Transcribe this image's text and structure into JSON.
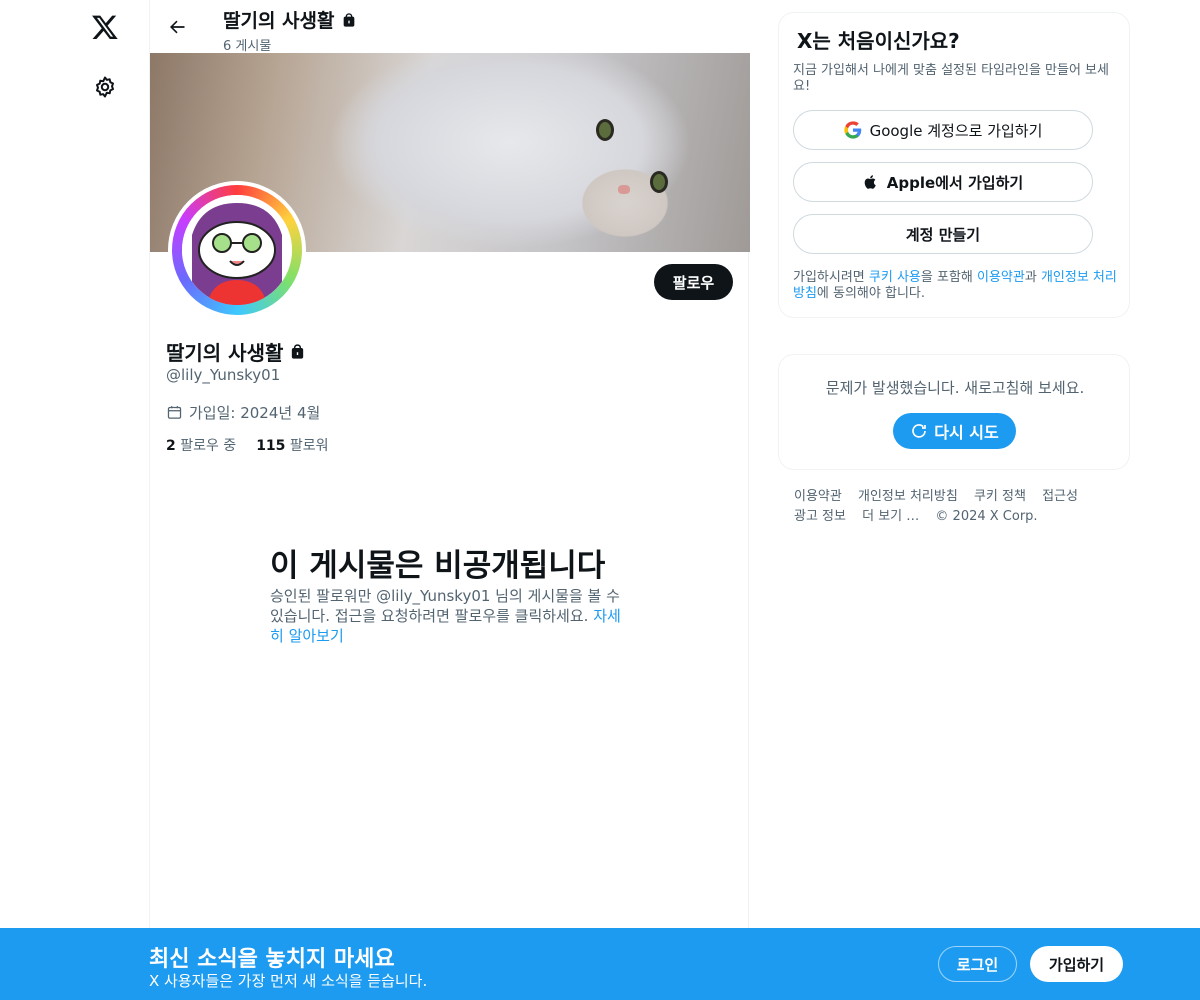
{
  "nav": {
    "logo_icon": "x-logo-icon",
    "settings_icon": "gear-icon"
  },
  "header": {
    "title": "딸기의 사생활",
    "post_count": "6 게시물"
  },
  "profile": {
    "name": "딸기의 사생활",
    "handle": "@lily_Yunsky01",
    "joined": "가입일: 2024년 4월",
    "following_count": "2",
    "following_label": "팔로우 중",
    "followers_count": "115",
    "followers_label": "팔로워",
    "follow_button": "팔로우",
    "protected": true
  },
  "private_notice": {
    "title": "이 게시물은 비공개됩니다",
    "text": "승인된 팔로워만 @lily_Yunsky01 님의 게시물을 볼 수 있습니다. 접근을 요청하려면 팔로우를 클릭하세요. ",
    "link": "자세히 알아보기"
  },
  "signup": {
    "title": "X는 처음이신가요?",
    "subtitle": "지금 가입해서 나에게 맞춤 설정된 타임라인을 만들어 보세요!",
    "google_button": "Google 계정으로 가입하기",
    "apple_button": "Apple에서 가입하기",
    "create_button": "계정 만들기",
    "terms_prefix": "가입하시려면 ",
    "terms_cookie": "쿠키 사용",
    "terms_mid1": "을 포함해 ",
    "terms_tos": "이용약관",
    "terms_mid2": "과 ",
    "terms_privacy": "개인정보 처리방침",
    "terms_suffix": "에 동의해야 합니다."
  },
  "error_card": {
    "message": "문제가 발생했습니다. 새로고침해 보세요.",
    "retry_button": "다시 시도"
  },
  "footer": {
    "links": [
      "이용약관",
      "개인정보 처리방침",
      "쿠키 정책",
      "접근성",
      "광고 정보",
      "더 보기 …"
    ],
    "copyright": "© 2024 X Corp."
  },
  "bottom_bar": {
    "title": "최신 소식을 놓치지 마세요",
    "subtitle": "X 사용자들은 가장 먼저 새 소식을 듣습니다.",
    "login_button": "로그인",
    "signup_button": "가입하기"
  },
  "colors": {
    "accent": "#1d9bf0",
    "text": "#0f1419",
    "muted": "#536471",
    "border": "#eff3f4"
  }
}
